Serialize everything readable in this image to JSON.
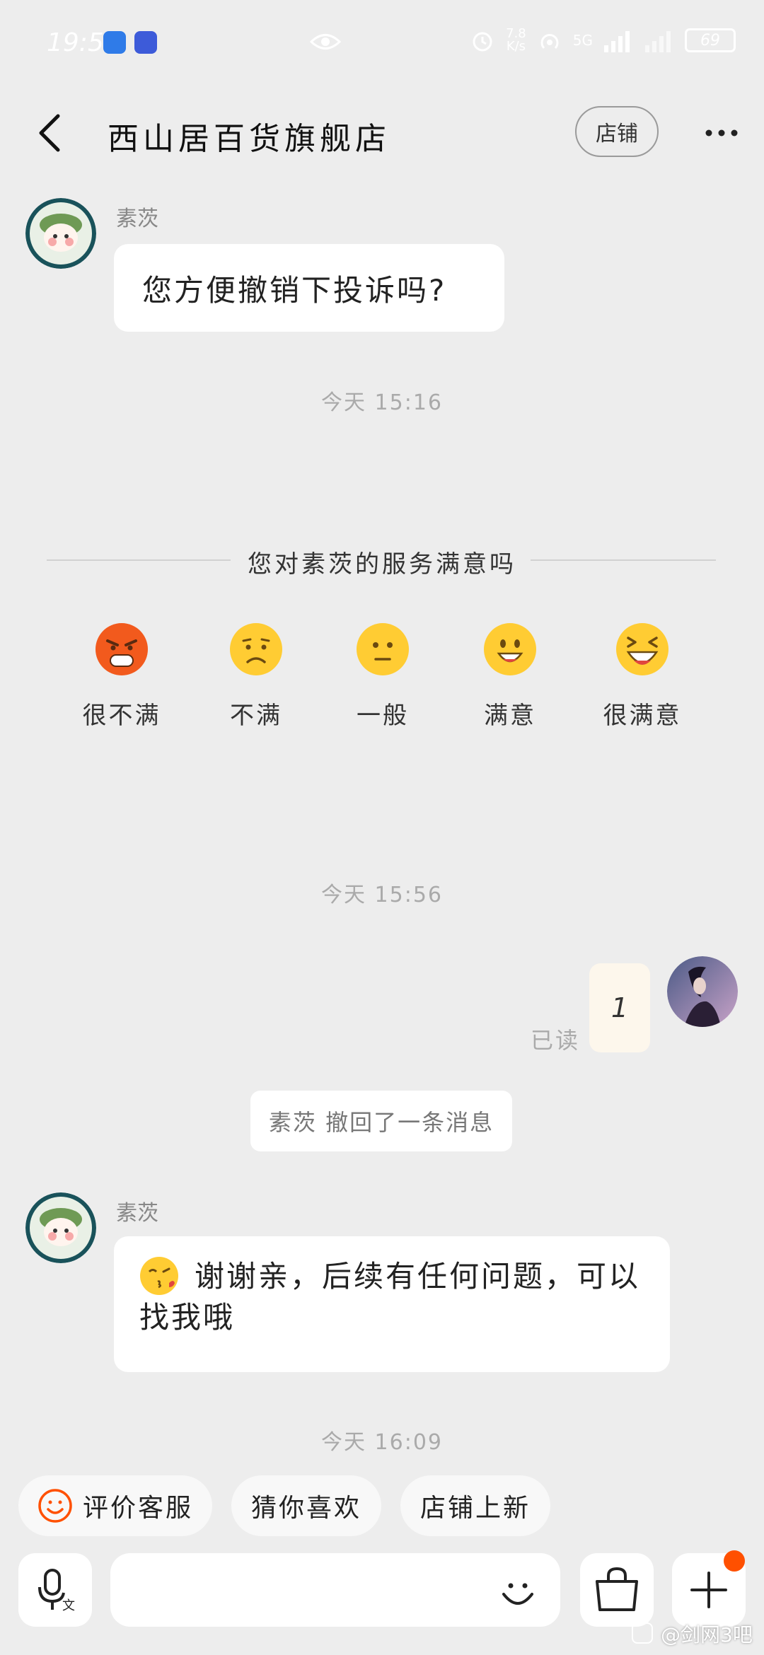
{
  "status_bar": {
    "time": "19:52",
    "speed_top": "7.8",
    "speed_bottom": "K/s",
    "network": "5G",
    "battery": "69"
  },
  "header": {
    "title": "西山居百货旗舰店",
    "shop_button": "店铺"
  },
  "messages": {
    "msg1": {
      "sender": "素茨",
      "text": "您方便撤销下投诉吗?"
    },
    "time1": "今天 15:16",
    "survey": {
      "title": "您对素茨的服务满意吗",
      "options": [
        {
          "label": "很不满",
          "icon": "angry-face-icon"
        },
        {
          "label": "不满",
          "icon": "frowning-face-icon"
        },
        {
          "label": "一般",
          "icon": "neutral-face-icon"
        },
        {
          "label": "满意",
          "icon": "smiling-face-icon"
        },
        {
          "label": "很满意",
          "icon": "laughing-face-icon"
        }
      ]
    },
    "time2": "今天 15:56",
    "my_msg": {
      "text": "1",
      "status": "已读"
    },
    "recall_note": "素茨 撤回了一条消息",
    "msg2": {
      "sender": "素茨",
      "text": "谢谢亲，后续有任何问题，可以找我哦"
    },
    "time3": "今天 16:09"
  },
  "quick_replies": [
    {
      "label": "评价客服",
      "icon": "smile-icon"
    },
    {
      "label": "猜你喜欢"
    },
    {
      "label": "店铺上新"
    }
  ],
  "input": {
    "placeholder": ""
  },
  "watermark": "@剑网3吧",
  "colors": {
    "accent": "#ff5000",
    "background": "#ededed",
    "my_bubble": "#fdf7ec"
  }
}
